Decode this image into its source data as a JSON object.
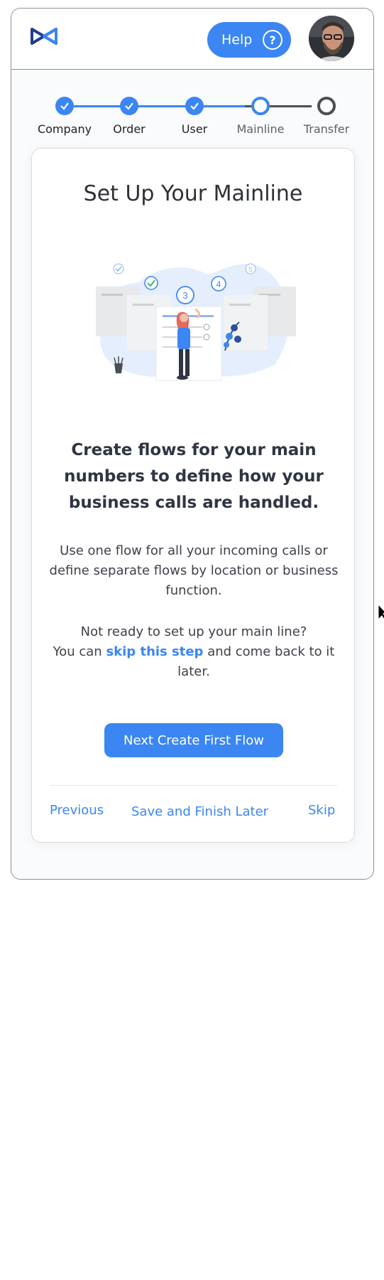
{
  "header": {
    "help_label": "Help",
    "help_icon_glyph": "?"
  },
  "stepper": {
    "steps": [
      {
        "label": "Company",
        "state": "done"
      },
      {
        "label": "Order",
        "state": "done"
      },
      {
        "label": "User",
        "state": "done"
      },
      {
        "label": "Mainline",
        "state": "current"
      },
      {
        "label": "Transfer",
        "state": "pending"
      }
    ]
  },
  "card": {
    "title": "Set Up Your Mainline",
    "illustration_steps": [
      "3",
      "4",
      "5"
    ],
    "headline": "Create flows for your main numbers to define how your business calls are handled.",
    "description": "Use one flow for all your incoming calls or define separate flows by location or business function.",
    "skip_prompt_line1": "Not ready to set up your main line?",
    "skip_prompt_prefix": "You can",
    "skip_link": "skip this step",
    "skip_prompt_suffix": "and come back to it later.",
    "next_button": "Next Create First Flow",
    "footer": {
      "previous": "Previous",
      "save_later": "Save and Finish Later",
      "skip": "Skip"
    }
  },
  "colors": {
    "accent": "#3b86f2",
    "pending": "#4a4f57",
    "logo": "#1c3d8f"
  }
}
